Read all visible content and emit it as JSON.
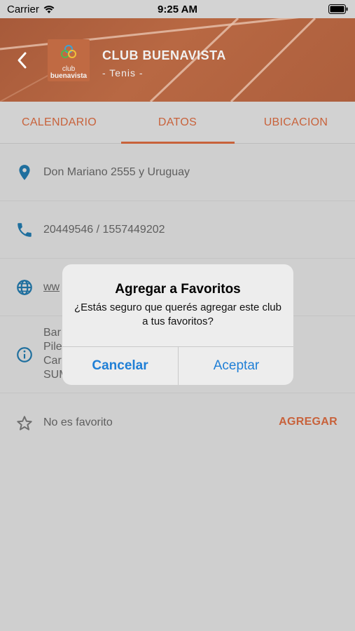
{
  "status_bar": {
    "carrier": "Carrier",
    "time": "9:25 AM"
  },
  "header": {
    "logo_text_top": "club",
    "logo_text_bottom": "buenavista",
    "title": "CLUB BUENAVISTA",
    "subtitle": "- Tenis -"
  },
  "tabs": [
    {
      "label": "CALENDARIO",
      "selected": false
    },
    {
      "label": "DATOS",
      "selected": true
    },
    {
      "label": "UBICACION",
      "selected": false
    }
  ],
  "details": {
    "address": "Don Mariano 2555 y Uruguay",
    "phone": "20449546 / 1557449202",
    "website": "ww",
    "description_lines": [
      "Bar",
      "Pile",
      "Car",
      "SUM"
    ],
    "favorite_status": "No es favorito",
    "favorite_action": "AGREGAR"
  },
  "dialog": {
    "title": "Agregar a Favoritos",
    "message": "¿Estás seguro que querés agregar este club a tus favoritos?",
    "cancel_label": "Cancelar",
    "accept_label": "Aceptar"
  },
  "colors": {
    "accent": "#c8623b",
    "link": "#2b6e93",
    "ios_blue": "#1f7fd6",
    "icon_blue": "#1f6f9e"
  },
  "icons": {
    "address": "location-pin-icon",
    "phone": "phone-icon",
    "website": "globe-icon",
    "info": "info-icon",
    "favorite": "star-outline-icon"
  }
}
